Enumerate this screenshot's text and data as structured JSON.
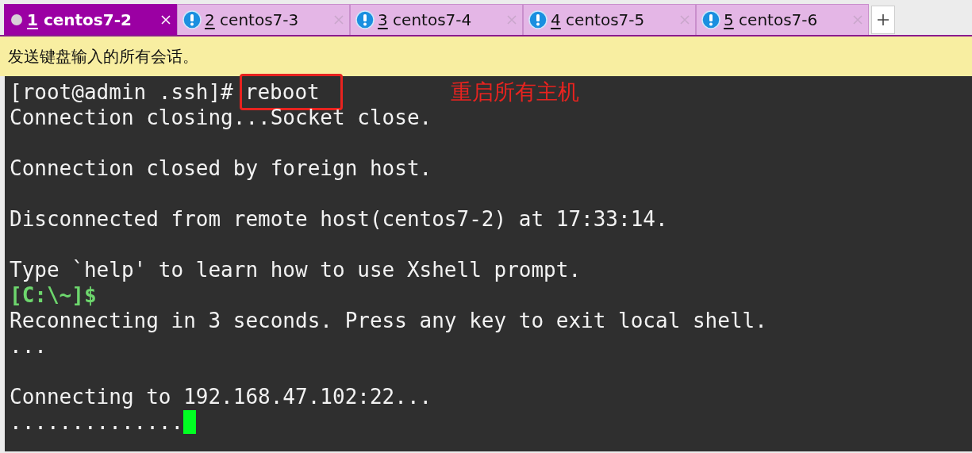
{
  "tabs": [
    {
      "number": "1",
      "label": "centos7-2",
      "selected": true,
      "alert": false
    },
    {
      "number": "2",
      "label": "centos7-3",
      "selected": false,
      "alert": true
    },
    {
      "number": "3",
      "label": "centos7-4",
      "selected": false,
      "alert": true
    },
    {
      "number": "4",
      "label": "centos7-5",
      "selected": false,
      "alert": true
    },
    {
      "number": "5",
      "label": "centos7-6",
      "selected": false,
      "alert": true
    }
  ],
  "broadcast_bar": {
    "text": "发送键盘输入的所有会话。"
  },
  "terminal": {
    "lines": [
      {
        "kind": "command",
        "prompt": "[root@admin .ssh]#",
        "command": "reboot",
        "annotation": "重启所有主机"
      },
      {
        "kind": "output",
        "text": "Connection closing...Socket close."
      },
      {
        "kind": "blank"
      },
      {
        "kind": "output",
        "text": "Connection closed by foreign host."
      },
      {
        "kind": "blank"
      },
      {
        "kind": "output",
        "text": "Disconnected from remote host(centos7-2) at 17:33:14."
      },
      {
        "kind": "blank"
      },
      {
        "kind": "output",
        "text": "Type `help' to learn how to use Xshell prompt."
      },
      {
        "kind": "local_prompt",
        "text": "[C:\\~]$"
      },
      {
        "kind": "output",
        "text": "Reconnecting in 3 seconds. Press any key to exit local shell."
      },
      {
        "kind": "output",
        "text": "..."
      },
      {
        "kind": "blank"
      },
      {
        "kind": "output",
        "text": "Connecting to 192.168.47.102:22..."
      },
      {
        "kind": "output",
        "text": "..............",
        "cursor": true
      }
    ]
  }
}
